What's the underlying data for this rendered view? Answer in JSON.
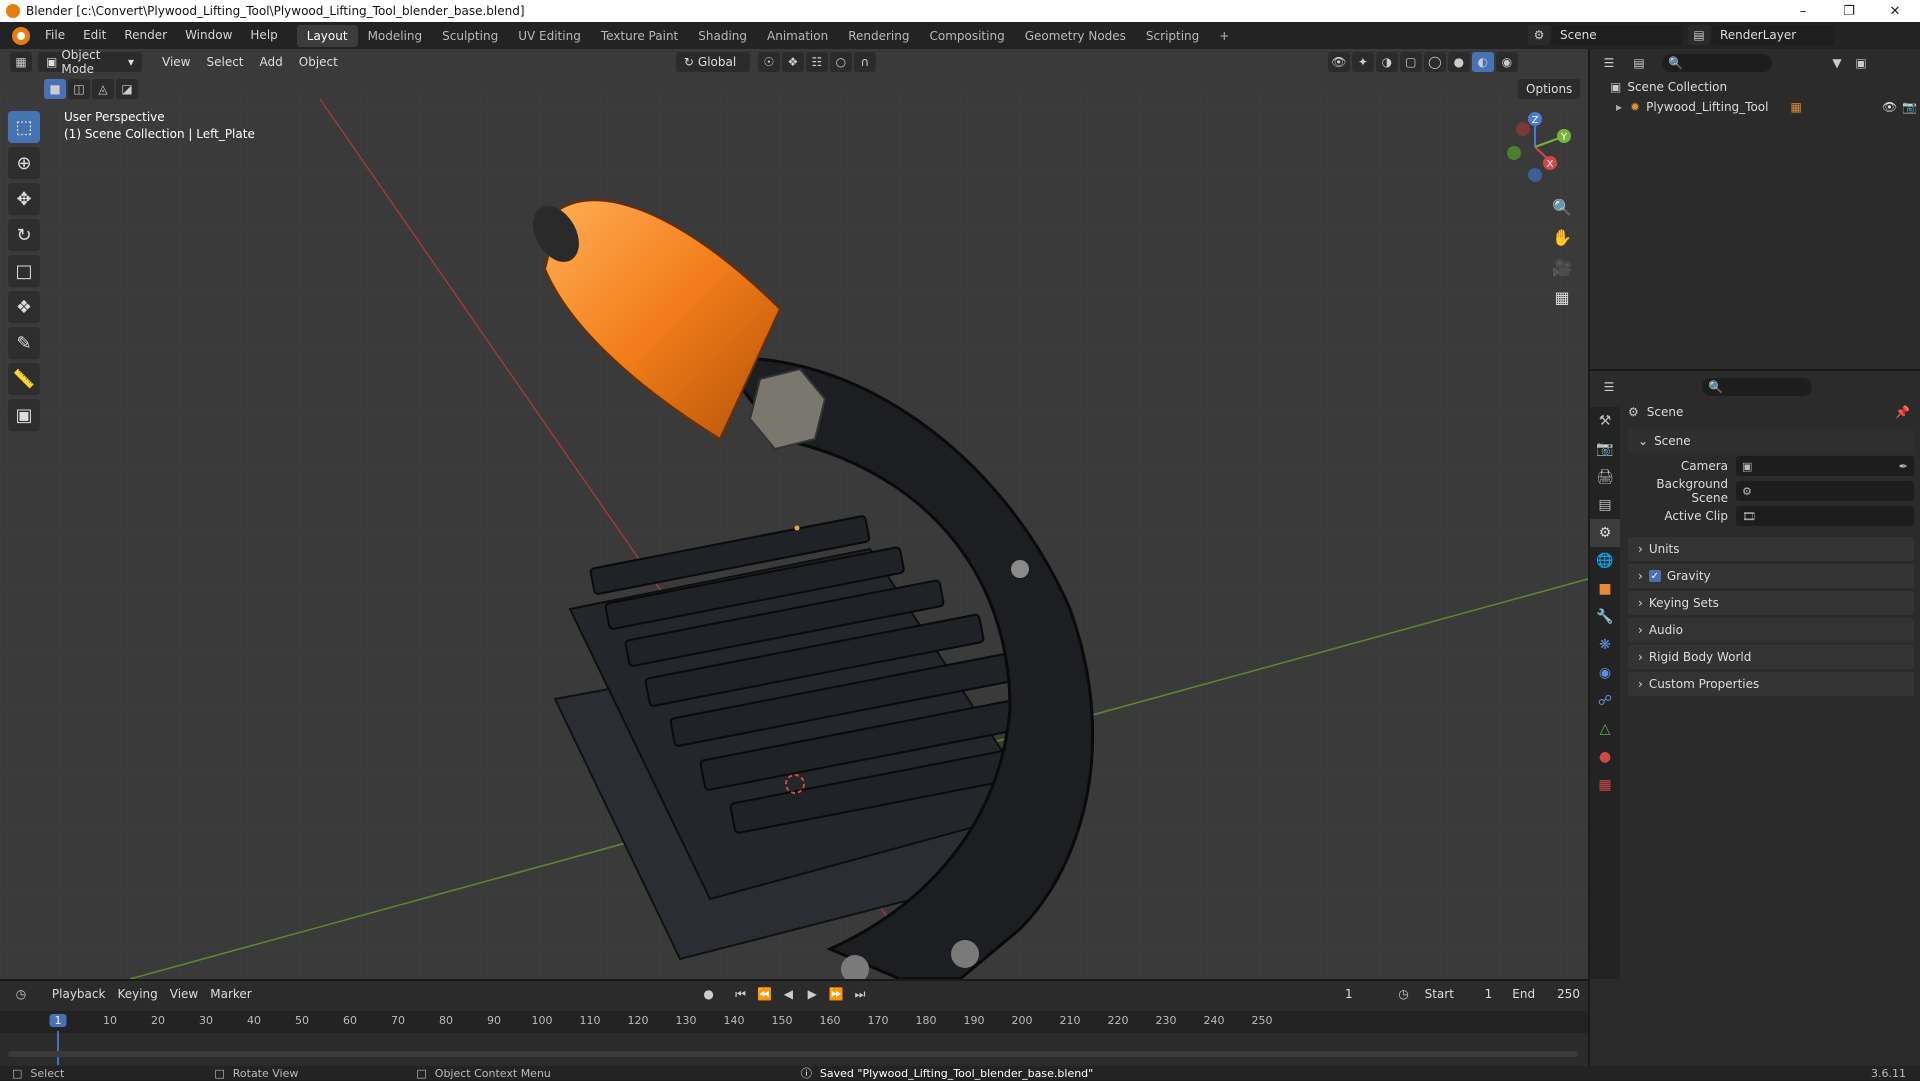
{
  "window": {
    "title": "Blender [c:\\Convert\\Plywood_Lifting_Tool\\Plywood_Lifting_Tool_blender_base.blend]",
    "minimize": "–",
    "maximize": "❐",
    "close": "✕"
  },
  "menu": [
    "File",
    "Edit",
    "Render",
    "Window",
    "Help"
  ],
  "workspaces": [
    {
      "label": "Layout",
      "active": true
    },
    {
      "label": "Modeling"
    },
    {
      "label": "Sculpting"
    },
    {
      "label": "UV Editing"
    },
    {
      "label": "Texture Paint"
    },
    {
      "label": "Shading"
    },
    {
      "label": "Animation"
    },
    {
      "label": "Rendering"
    },
    {
      "label": "Compositing"
    },
    {
      "label": "Geometry Nodes"
    },
    {
      "label": "Scripting"
    }
  ],
  "add_workspace": "+",
  "scene_selector": {
    "label": "Scene"
  },
  "view_layer": {
    "label": "RenderLayer"
  },
  "viewport": {
    "mode": "Object Mode",
    "menus": [
      "View",
      "Select",
      "Add",
      "Object"
    ],
    "orientation": "Global",
    "options": "Options",
    "perspective_label": "User Perspective",
    "collection_label": "(1) Scene Collection | Left_Plate",
    "gizmo": {
      "x": "X",
      "y": "Y",
      "z": "Z"
    }
  },
  "outliner": {
    "root": "Scene Collection",
    "items": [
      {
        "label": "Plywood_Lifting_Tool"
      }
    ]
  },
  "properties": {
    "context": "Scene",
    "section": "Scene",
    "fields": [
      {
        "label": "Camera",
        "value": ""
      },
      {
        "label": "Background Scene",
        "value": ""
      },
      {
        "label": "Active Clip",
        "value": ""
      }
    ],
    "panels": [
      {
        "label": "Units",
        "checkbox": false
      },
      {
        "label": "Gravity",
        "checkbox": true
      },
      {
        "label": "Keying Sets",
        "checkbox": false
      },
      {
        "label": "Audio",
        "checkbox": false
      },
      {
        "label": "Rigid Body World",
        "checkbox": false
      },
      {
        "label": "Custom Properties",
        "checkbox": false
      }
    ]
  },
  "timeline": {
    "menus": [
      "Playback",
      "Keying",
      "View",
      "Marker"
    ],
    "current_frame": "1",
    "start_label": "Start",
    "start": "1",
    "end_label": "End",
    "end": "250",
    "ticks": [
      "1",
      "10",
      "20",
      "30",
      "40",
      "50",
      "60",
      "70",
      "80",
      "90",
      "100",
      "110",
      "120",
      "130",
      "140",
      "150",
      "160",
      "170",
      "180",
      "190",
      "200",
      "210",
      "220",
      "230",
      "240",
      "250"
    ]
  },
  "status": {
    "select": "Select",
    "rotate": "Rotate View",
    "context_menu": "Object Context Menu",
    "message": "Saved \"Plywood_Lifting_Tool_blender_base.blend\"",
    "version": "3.6.11"
  }
}
